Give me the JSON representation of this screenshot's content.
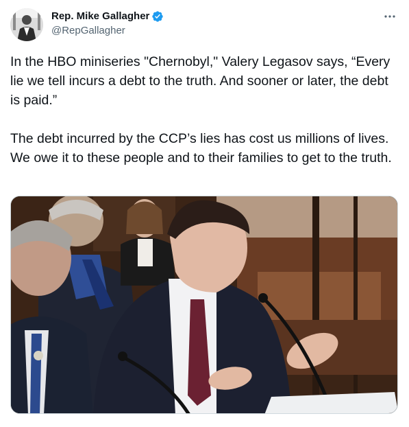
{
  "author": {
    "display_name": "Rep. Mike Gallagher",
    "handle": "@RepGallagher",
    "verified": true,
    "verified_icon": "verified-badge-icon",
    "avatar_icon": "profile-photo"
  },
  "menu": {
    "icon": "more-horizontal-icon"
  },
  "tweet": {
    "paragraph_1": "In the HBO miniseries \"Chernobyl,\" Valery Legasov says, “Every lie we tell incurs a debt to the truth. And sooner or later, the debt is paid.”",
    "paragraph_2": "The debt incurred by the CCP’s lies has cost us millions of lives. We owe it to these people and to their families to get to the truth."
  },
  "media": {
    "kind": "video-still",
    "icon": "embedded-video-frame"
  },
  "colors": {
    "text_primary": "#0f1419",
    "text_secondary": "#536471",
    "verified_blue": "#1d9bf0",
    "border": "#cfd9de"
  }
}
